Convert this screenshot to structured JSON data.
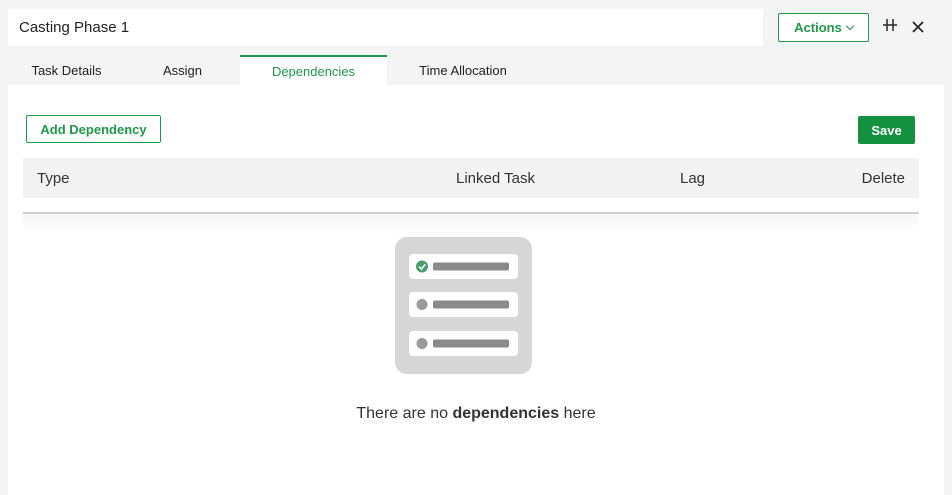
{
  "header": {
    "title": "Casting Phase 1",
    "actions_label": "Actions"
  },
  "icons": {
    "split": "split-view-icon",
    "close": "close-icon",
    "chevron": "chevron-down-icon",
    "empty": "empty-list-illustration"
  },
  "tabs": [
    {
      "label": "Task Details",
      "active": false
    },
    {
      "label": "Assign",
      "active": false
    },
    {
      "label": "Dependencies",
      "active": true
    },
    {
      "label": "Time Allocation",
      "active": false
    }
  ],
  "toolbar": {
    "add_label": "Add Dependency",
    "save_label": "Save"
  },
  "table": {
    "columns": [
      "Type",
      "Linked Task",
      "Lag",
      "Delete"
    ],
    "rows": []
  },
  "empty_state": {
    "prefix": "There are no ",
    "bold": "dependencies",
    "suffix": " here"
  },
  "colors": {
    "accent": "#1f9a4a",
    "save": "#13913f"
  }
}
